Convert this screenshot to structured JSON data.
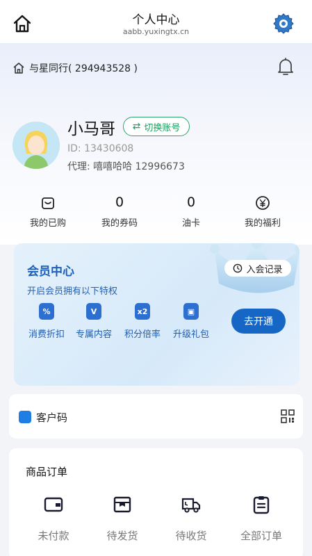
{
  "header": {
    "title": "个人中心",
    "url": "aabb.yuxingtx.cn",
    "home_icon": "home-icon",
    "settings_icon": "gear-icon"
  },
  "group": {
    "label": "与星同行( 294943528 )",
    "bell_icon": "bell-icon"
  },
  "profile": {
    "name": "小马哥",
    "switch_label": "切换账号",
    "id_text": "ID: 13430608",
    "agent_text": "代理: 嘻嘻哈哈 12996673"
  },
  "stats": [
    {
      "value": "",
      "icon": "purchase-icon",
      "label": "我的已购"
    },
    {
      "value": "0",
      "label": "我的券码"
    },
    {
      "value": "0",
      "label": "油卡"
    },
    {
      "value": "",
      "icon": "yen-icon",
      "label": "我的福利"
    }
  ],
  "vip": {
    "title": "会员中心",
    "subtitle": "开启会员拥有以下特权",
    "record_label": "入会记录",
    "perks": [
      {
        "glyph": "%",
        "label": "消费折扣"
      },
      {
        "glyph": "V",
        "label": "专属内容"
      },
      {
        "glyph": "x2",
        "label": "积分倍率"
      },
      {
        "glyph": "▣",
        "label": "升级礼包"
      }
    ],
    "cta": "去开通",
    "accent": "#1666c5"
  },
  "customer_code": {
    "label": "客户码",
    "icon": "qr-code-icon"
  },
  "orders": {
    "title": "商品订单",
    "items": [
      {
        "label": "未付款",
        "icon": "wallet-icon"
      },
      {
        "label": "待发货",
        "icon": "box-icon"
      },
      {
        "label": "待收货",
        "icon": "truck-icon"
      },
      {
        "label": "全部订单",
        "icon": "clipboard-icon"
      }
    ]
  }
}
